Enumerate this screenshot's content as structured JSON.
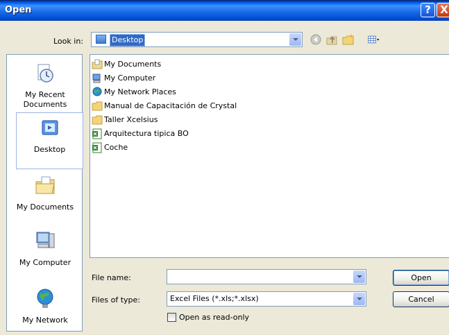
{
  "window": {
    "title": "Open"
  },
  "titlebar_buttons": {
    "help": "?",
    "close": "X"
  },
  "lookin": {
    "label": "Look in:",
    "value": "Desktop"
  },
  "toolbar": {
    "icons": [
      "back-icon",
      "up-folder-icon",
      "new-folder-icon",
      "views-menu-icon"
    ]
  },
  "places": [
    {
      "label": "My Recent Documents",
      "icon": "recent-documents-icon"
    },
    {
      "label": "Desktop",
      "icon": "desktop-icon"
    },
    {
      "label": "My Documents",
      "icon": "my-documents-icon"
    },
    {
      "label": "My Computer",
      "icon": "my-computer-icon"
    },
    {
      "label": "My Network",
      "icon": "my-network-icon"
    }
  ],
  "files": [
    {
      "name": "My Documents",
      "icon": "my-documents-icon"
    },
    {
      "name": "My Computer",
      "icon": "my-computer-icon"
    },
    {
      "name": "My Network Places",
      "icon": "network-places-icon"
    },
    {
      "name": "Manual  de Capacitación de Crystal",
      "icon": "folder-icon"
    },
    {
      "name": "Taller Xcelsius",
      "icon": "folder-icon"
    },
    {
      "name": "Arquitectura tipica BO",
      "icon": "excel-file-icon"
    },
    {
      "name": "Coche",
      "icon": "excel-file-icon"
    }
  ],
  "form": {
    "file_name_label": "File name:",
    "file_name_value": "",
    "file_type_label": "Files of type:",
    "file_type_value": "Excel Files (*.xls;*.xlsx)",
    "readonly_label": "Open as read-only"
  },
  "buttons": {
    "open": "Open",
    "cancel": "Cancel"
  },
  "colors": {
    "title_bar": "#0058EE",
    "selection": "#316AC5",
    "face": "#ECE9D8"
  }
}
